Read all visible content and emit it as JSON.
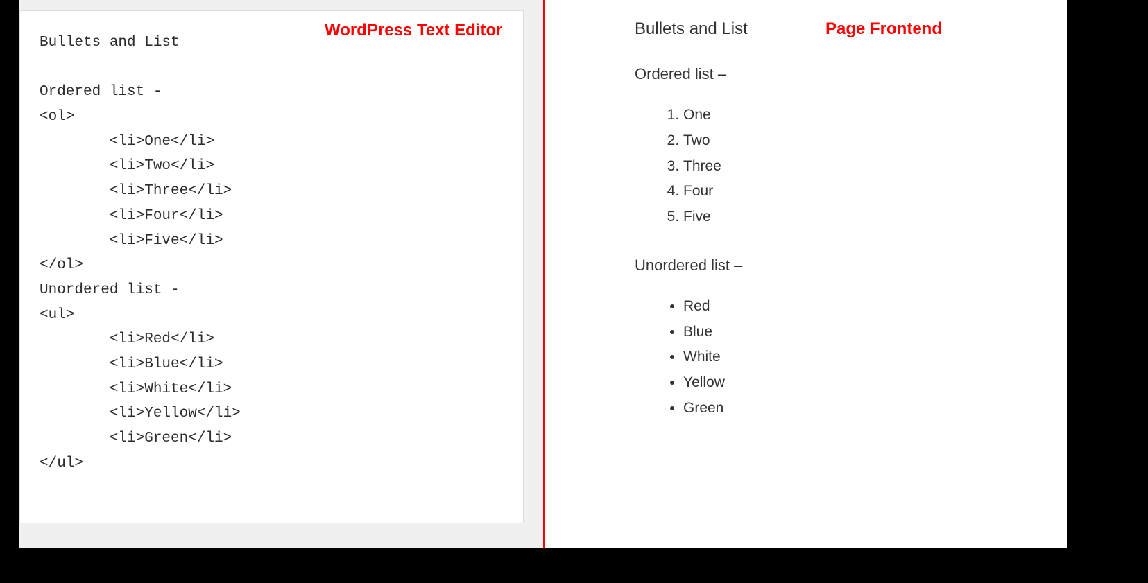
{
  "leftAnnotation": "WordPress Text Editor",
  "rightAnnotation": "Page Frontend",
  "editor": {
    "raw": "Bullets and List\n\nOrdered list -\n<ol>\n        <li>One</li>\n        <li>Two</li>\n        <li>Three</li>\n        <li>Four</li>\n        <li>Five</li>\n</ol>\nUnordered list -\n<ul>\n        <li>Red</li>\n        <li>Blue</li>\n        <li>White</li>\n        <li>Yellow</li>\n        <li>Green</li>\n</ul>"
  },
  "frontend": {
    "title": "Bullets and List",
    "orderedHeading": "Ordered list –",
    "orderedItems": [
      "One",
      "Two",
      "Three",
      "Four",
      "Five"
    ],
    "unorderedHeading": "Unordered list –",
    "unorderedItems": [
      "Red",
      "Blue",
      "White",
      "Yellow",
      "Green"
    ]
  }
}
